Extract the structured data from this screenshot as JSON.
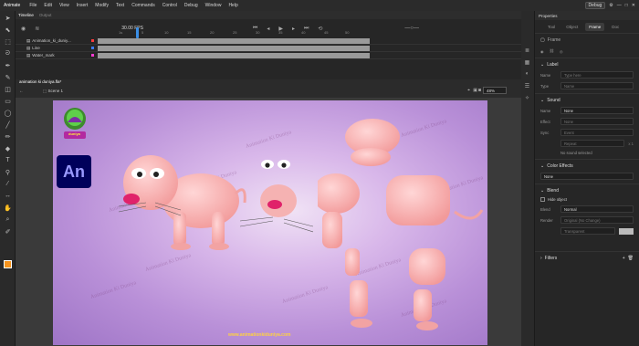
{
  "app": {
    "logo_label": "Animate",
    "menu": [
      "File",
      "Edit",
      "View",
      "Insert",
      "Modify",
      "Text",
      "Commands",
      "Control",
      "Debug",
      "Window",
      "Help"
    ],
    "workspace_btn": "Debug"
  },
  "timeline": {
    "tabs": [
      "Timeline",
      "Output"
    ],
    "fps": "30.00",
    "fps_unit": "FPS",
    "current_frame": "1",
    "ruler": [
      "1s",
      "5",
      "10",
      "15",
      "20",
      "25",
      "30",
      "35",
      "40",
      "45",
      "50"
    ],
    "layers": [
      {
        "name": "Animation_ki_duniy...",
        "color": "#ff3b3b"
      },
      {
        "name": "Line",
        "color": "#3b7bff"
      },
      {
        "name": "Water_mark",
        "color": "#ff3bd0"
      }
    ]
  },
  "document": {
    "tab_label": "animation ki duniya.fla*",
    "scene_label": "Scene 1",
    "zoom": "48%"
  },
  "canvas": {
    "watermark": "Animation Ki Duniya",
    "an_logo": "An",
    "bottom_link": "www.animationkiduniya.com",
    "brand_text": "duniya"
  },
  "properties": {
    "title": "Properties",
    "tabs": [
      "Tool",
      "Object",
      "Frame",
      "Doc"
    ],
    "active_tab": "Frame",
    "frame_label": "Frame",
    "label_section": "Label",
    "label_name_lbl": "Name",
    "label_name_placeholder": "Type here",
    "label_type_lbl": "Type",
    "label_type_value": "Name",
    "sound_section": "Sound",
    "sound_name_lbl": "Name",
    "sound_name_value": "None",
    "sound_effect_lbl": "Effect",
    "sound_effect_value": "None",
    "sound_sync_lbl": "Sync",
    "sound_sync_value": "Event",
    "sound_repeat_value": "Repeat",
    "sound_repeat_count": "x 1",
    "sound_status": "No sound selected",
    "color_section": "Color Effects",
    "color_value": "None",
    "blend_section": "Blend",
    "hide_object": "Hide object",
    "blend_lbl": "Blend",
    "blend_value": "Normal",
    "render_lbl": "Render",
    "render_value": "Original (No Change)",
    "transparent_value": "Transparent",
    "filters_section": "Filters"
  }
}
